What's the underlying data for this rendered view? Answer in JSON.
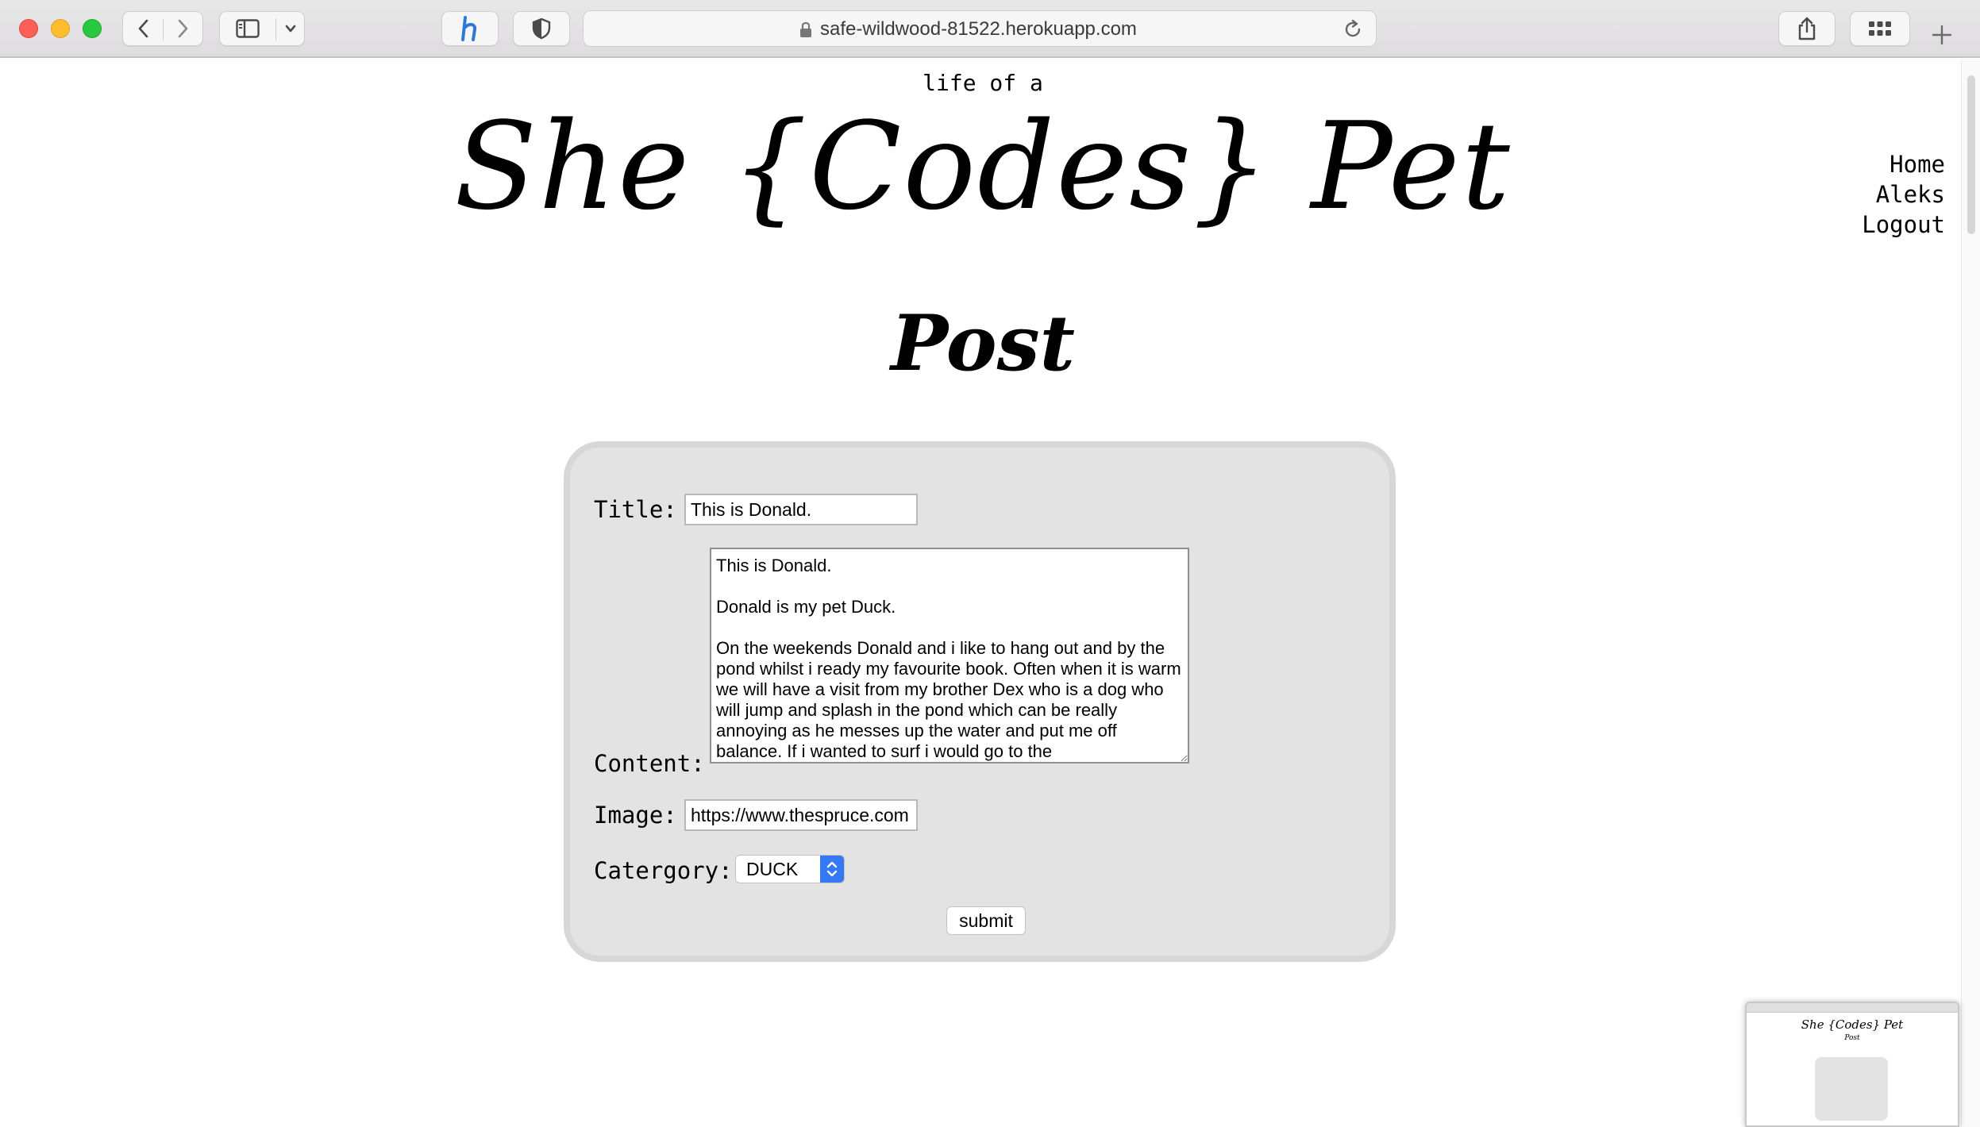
{
  "browser": {
    "url": "safe-wildwood-81522.herokuapp.com",
    "traffic_colors": {
      "close": "#fe5f57",
      "minimize": "#febc2e",
      "zoom": "#28c840"
    },
    "icons": [
      "back-icon",
      "forward-icon",
      "sidebar-icon",
      "chevron-down-icon",
      "honey-extension-icon",
      "privacy-shield-icon",
      "lock-icon",
      "reload-icon",
      "share-icon",
      "tab-overview-icon",
      "new-tab-icon"
    ]
  },
  "header": {
    "tagline": "life of a",
    "site_title": "She {Codes} Pet"
  },
  "nav": {
    "home": "Home",
    "user": "Aleks",
    "logout": "Logout"
  },
  "page": {
    "heading": "Post"
  },
  "form": {
    "title_label": "Title:",
    "title_value": "This is Donald.",
    "content_label": "Content:",
    "content_value": "This is Donald.\n\nDonald is my pet Duck.\n\nOn the weekends Donald and i like to hang out and by the pond whilst i ready my favourite book. Often when it is warm we will have a visit from my brother Dex who is a dog who will jump and splash in the pond which can be really annoying as he messes up the water and put me off balance. If i wanted to surf i would go to the",
    "image_label": "Image:",
    "image_value": "https://www.thespruce.com",
    "category_label": "Catergory:",
    "category_value": "DUCK",
    "submit_label": "submit",
    "card_color": "#e3e3e3",
    "select_accent": "#3478f6"
  },
  "thumbnail": {
    "title": "She {Codes} Pet",
    "heading": "Post"
  }
}
